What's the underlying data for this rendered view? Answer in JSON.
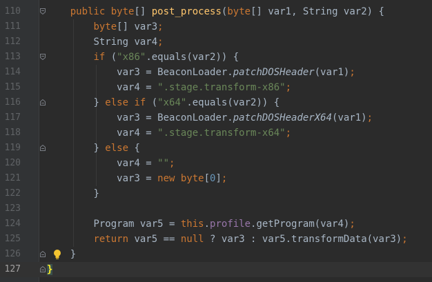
{
  "line_numbers": [
    "110",
    "111",
    "112",
    "113",
    "114",
    "115",
    "116",
    "117",
    "118",
    "119",
    "120",
    "121",
    "122",
    "123",
    "124",
    "125",
    "126",
    "127"
  ],
  "current_line": "127",
  "code_lines": [
    {
      "indent": "    ",
      "tokens": [
        [
          "kw",
          "public "
        ],
        [
          "kw",
          "byte"
        ],
        [
          "t",
          "[] "
        ],
        [
          "fn",
          "post_process"
        ],
        [
          "t",
          "("
        ],
        [
          "kw",
          "byte"
        ],
        [
          "t",
          "[] var1, String var2) {"
        ]
      ]
    },
    {
      "indent": "        ",
      "tokens": [
        [
          "kw",
          "byte"
        ],
        [
          "t",
          "[] var3"
        ],
        [
          "kw",
          ";"
        ]
      ]
    },
    {
      "indent": "        ",
      "tokens": [
        [
          "t",
          "String var4"
        ],
        [
          "kw",
          ";"
        ]
      ]
    },
    {
      "indent": "        ",
      "tokens": [
        [
          "kw",
          "if "
        ],
        [
          "t",
          "("
        ],
        [
          "str",
          "\"x86\""
        ],
        [
          "t",
          ".equals(var2)) {"
        ]
      ]
    },
    {
      "indent": "            ",
      "tokens": [
        [
          "t",
          "var3 = BeaconLoader."
        ],
        [
          "it",
          "patchDOSHeader"
        ],
        [
          "t",
          "(var1)"
        ],
        [
          "kw",
          ";"
        ]
      ]
    },
    {
      "indent": "            ",
      "tokens": [
        [
          "t",
          "var4 = "
        ],
        [
          "str",
          "\".stage.transform-x86\""
        ],
        [
          "kw",
          ";"
        ]
      ]
    },
    {
      "indent": "        ",
      "tokens": [
        [
          "t",
          "} "
        ],
        [
          "kw",
          "else if "
        ],
        [
          "t",
          "("
        ],
        [
          "str",
          "\"x64\""
        ],
        [
          "t",
          ".equals(var2)) {"
        ]
      ]
    },
    {
      "indent": "            ",
      "tokens": [
        [
          "t",
          "var3 = BeaconLoader."
        ],
        [
          "it",
          "patchDOSHeaderX64"
        ],
        [
          "t",
          "(var1)"
        ],
        [
          "kw",
          ";"
        ]
      ]
    },
    {
      "indent": "            ",
      "tokens": [
        [
          "t",
          "var4 = "
        ],
        [
          "str",
          "\".stage.transform-x64\""
        ],
        [
          "kw",
          ";"
        ]
      ]
    },
    {
      "indent": "        ",
      "tokens": [
        [
          "t",
          "} "
        ],
        [
          "kw",
          "else "
        ],
        [
          "t",
          "{"
        ]
      ]
    },
    {
      "indent": "            ",
      "tokens": [
        [
          "t",
          "var4 = "
        ],
        [
          "str",
          "\"\""
        ],
        [
          "kw",
          ";"
        ]
      ]
    },
    {
      "indent": "            ",
      "tokens": [
        [
          "t",
          "var3 = "
        ],
        [
          "kw",
          "new byte"
        ],
        [
          "t",
          "["
        ],
        [
          "num",
          "0"
        ],
        [
          "t",
          "]"
        ],
        [
          "kw",
          ";"
        ]
      ]
    },
    {
      "indent": "        ",
      "tokens": [
        [
          "t",
          "}"
        ]
      ]
    },
    {
      "indent": "",
      "tokens": []
    },
    {
      "indent": "        ",
      "tokens": [
        [
          "t",
          "Program var5 = "
        ],
        [
          "kw",
          "this"
        ],
        [
          "t",
          "."
        ],
        [
          "fld",
          "profile"
        ],
        [
          "t",
          ".getProgram(var4)"
        ],
        [
          "kw",
          ";"
        ]
      ]
    },
    {
      "indent": "        ",
      "tokens": [
        [
          "kw",
          "return "
        ],
        [
          "t",
          "var5 == "
        ],
        [
          "kw",
          "null "
        ],
        [
          "t",
          "? var3 : var5.transformData(var3)"
        ],
        [
          "kw",
          ";"
        ]
      ]
    },
    {
      "indent": "    ",
      "tokens": [
        [
          "t",
          "}"
        ]
      ]
    },
    {
      "indent": "",
      "tokens": [
        [
          "brace",
          "}"
        ]
      ]
    }
  ],
  "colors": {
    "background": "#2b2b2b",
    "gutter": "#313335",
    "keyword": "#cc7832",
    "method": "#ffc66d",
    "string": "#6a8759",
    "number": "#6897bb",
    "field": "#9876aa",
    "text": "#a9b7c6"
  },
  "icons": {
    "fold_markers": [
      "fold-marker-icon"
    ],
    "intention": "lightbulb-icon"
  },
  "fold_lines": [
    "110",
    "113",
    "116",
    "119",
    "126",
    "127"
  ],
  "bulb_line": "126"
}
